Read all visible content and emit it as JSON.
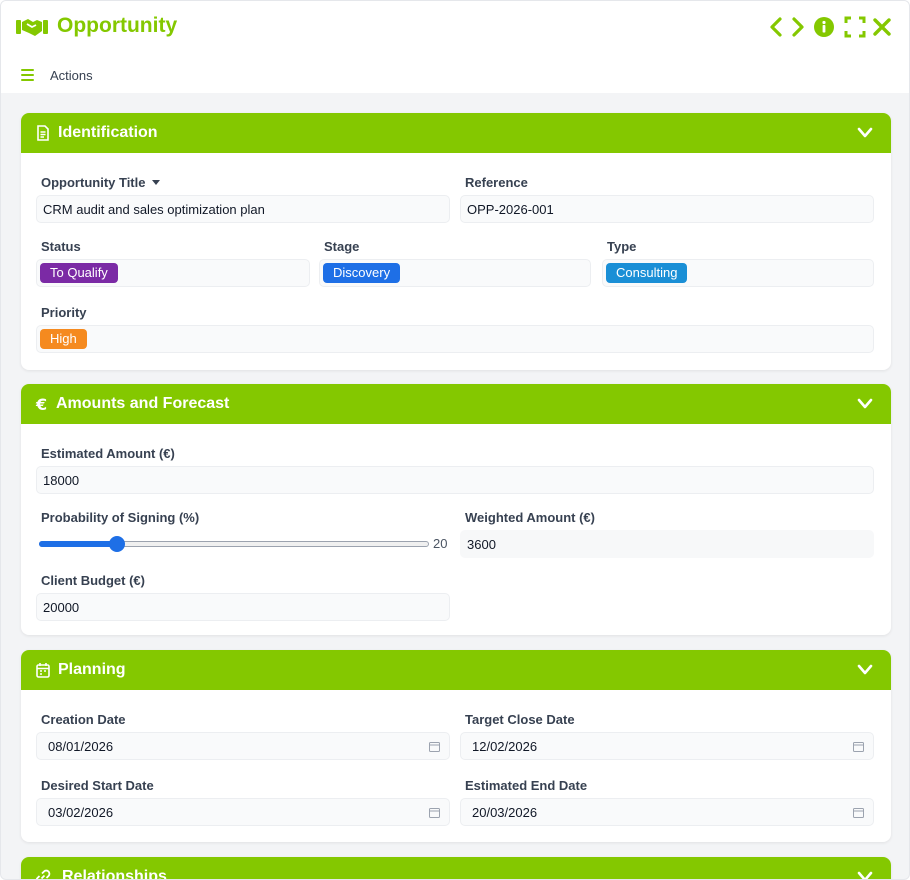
{
  "window": {
    "title": "Opportunity",
    "actions_label": "Actions",
    "buttons": [
      "previous",
      "next",
      "info",
      "fullscreen",
      "close"
    ]
  },
  "colors": {
    "accent": "#84c800",
    "status_to_qualify": "#7b2aa5",
    "stage_discovery": "#1e6fe6",
    "type_consulting": "#1a8fd6",
    "priority_high": "#f58a1f"
  },
  "sections": {
    "identification": {
      "title": "Identification",
      "icon": "document-icon",
      "opportunity_title_label": "Opportunity Title",
      "opportunity_title_value": "CRM audit and sales optimization plan",
      "reference_label": "Reference",
      "reference_value": "OPP-2026-001",
      "status_label": "Status",
      "status_value": "To Qualify",
      "stage_label": "Stage",
      "stage_value": "Discovery",
      "type_label": "Type",
      "type_value": "Consulting",
      "priority_label": "Priority",
      "priority_value": "High"
    },
    "amounts": {
      "title": "Amounts and Forecast",
      "icon": "euro-icon",
      "estimated_amount_label": "Estimated Amount (€)",
      "estimated_amount_value": "18000",
      "probability_label": "Probability of Signing (%)",
      "probability_value": "20",
      "weighted_amount_label": "Weighted Amount (€)",
      "weighted_amount_value": "3600",
      "client_budget_label": "Client Budget (€)",
      "client_budget_value": "20000"
    },
    "planning": {
      "title": "Planning",
      "icon": "calendar-icon",
      "creation_date_label": "Creation Date",
      "creation_date_value": "08/01/2026",
      "target_close_label": "Target Close Date",
      "target_close_value": "12/02/2026",
      "desired_start_label": "Desired Start Date",
      "desired_start_value": "03/02/2026",
      "estimated_end_label": "Estimated End Date",
      "estimated_end_value": "20/03/2026"
    },
    "relationships": {
      "title": "Relationships",
      "icon": "link-icon"
    }
  }
}
